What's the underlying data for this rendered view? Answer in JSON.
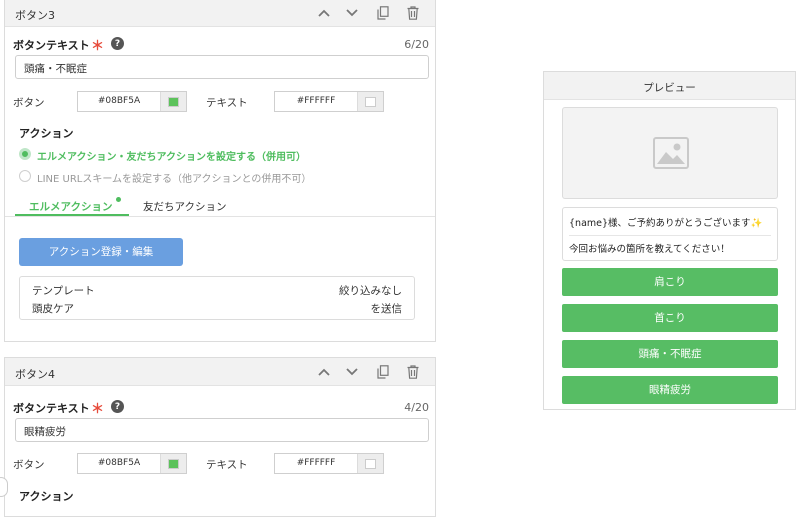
{
  "button3": {
    "title": "ボタン3",
    "text_label": "ボタンテキスト",
    "required_mark": "＊",
    "help_glyph": "?",
    "counter": "6/20",
    "text_value": "頭痛・不眠症",
    "button_label": "ボタン",
    "button_color": "#08BF5A",
    "text_label2": "テキスト",
    "text_color": "#FFFFFF",
    "action_heading": "アクション",
    "radio1": "エルメアクション・友だちアクションを設定する（併用可）",
    "radio2": "LINE URLスキームを設定する（他アクションとの併用不可）",
    "tab_active": "エルメアクション",
    "tab_other": "友だちアクション",
    "register_btn": "アクション登録・編集",
    "table": {
      "row1_left": "テンプレート",
      "row1_right": "絞り込みなし",
      "row2_left": "頭皮ケア",
      "row2_right": "を送信"
    }
  },
  "button4": {
    "title": "ボタン4",
    "text_label": "ボタンテキスト",
    "required_mark": "＊",
    "help_glyph": "?",
    "counter": "4/20",
    "text_value": "眼精疲労",
    "button_label": "ボタン",
    "button_color": "#08BF5A",
    "text_label2": "テキスト",
    "text_color": "#FFFFFF",
    "action_heading": "アクション"
  },
  "preview": {
    "title": "プレビュー",
    "message_line1": "{name}様、ご予約ありがとうございます✨",
    "message_line2": "今回お悩みの箇所を教えてください！",
    "buttons": [
      "肩こり",
      "首こり",
      "頭痛・不眠症",
      "眼精疲労"
    ]
  },
  "colors": {
    "accent_green": "#4fbd5f",
    "register_blue": "#6a9fe0",
    "swatch_green": "#5cc25b"
  },
  "icons": [
    "chevron-up-icon",
    "chevron-down-icon",
    "copy-icon",
    "trash-icon",
    "image-placeholder-icon"
  ]
}
